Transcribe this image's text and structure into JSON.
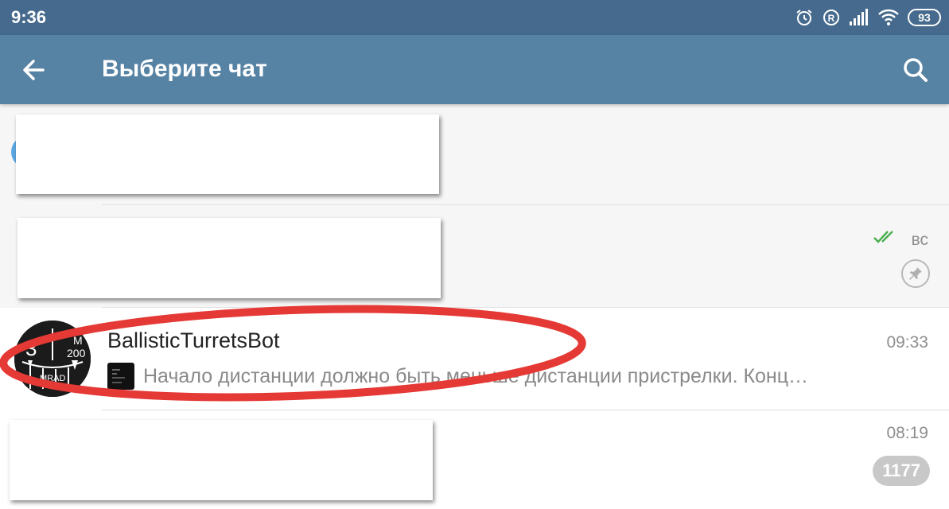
{
  "status_bar": {
    "time": "9:36",
    "battery": "93"
  },
  "app_bar": {
    "title": "Выберите чат"
  },
  "chats": [
    {
      "redacted": true
    },
    {
      "redacted": true,
      "time": "вс",
      "pinned": true,
      "read_status": "double-check"
    },
    {
      "name": "BallisticTurretsBot",
      "time": "09:33",
      "preview": "Начало дистанции должно быть меньше дистанции пристрелки. Конц…",
      "avatar_text": {
        "left": "3",
        "m": "M",
        "num": "200",
        "bottom": "MRAD"
      }
    },
    {
      "redacted": true,
      "time": "08:19",
      "unread": "1177"
    }
  ],
  "icons": {
    "back": "arrow-left-icon",
    "search": "search-icon",
    "pin": "pin-icon",
    "alarm": "alarm-icon",
    "registered": "registered-icon",
    "signal": "signal-icon",
    "wifi": "wifi-icon"
  },
  "colors": {
    "status_bar": "#456a8d",
    "app_bar": "#5682a3",
    "check_green": "#4caf50",
    "highlight_red": "#e53935"
  }
}
